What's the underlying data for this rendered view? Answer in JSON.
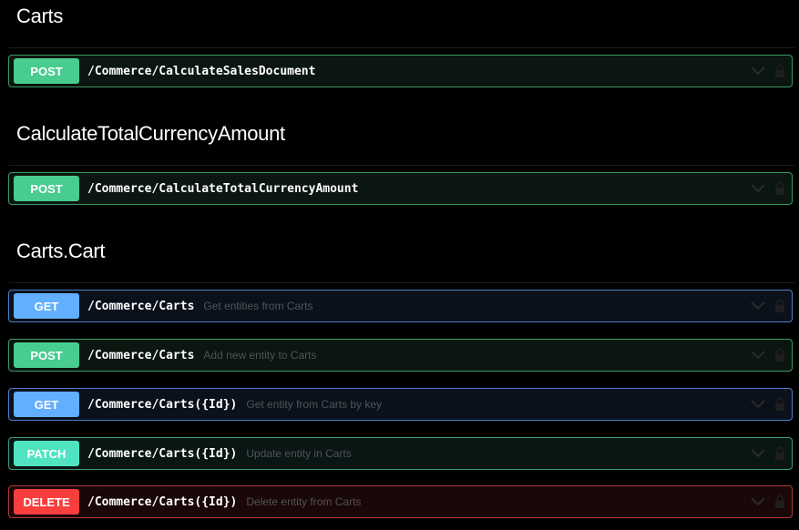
{
  "sections": [
    {
      "title": "Carts",
      "operations": [
        {
          "method": "POST",
          "path": "/Commerce/CalculateSalesDocument",
          "summary": ""
        }
      ]
    },
    {
      "title": "CalculateTotalCurrencyAmount",
      "operations": [
        {
          "method": "POST",
          "path": "/Commerce/CalculateTotalCurrencyAmount",
          "summary": ""
        }
      ]
    },
    {
      "title": "Carts.Cart",
      "operations": [
        {
          "method": "GET",
          "path": "/Commerce/Carts",
          "summary": "Get entities from Carts"
        },
        {
          "method": "POST",
          "path": "/Commerce/Carts",
          "summary": "Add new entity to Carts"
        },
        {
          "method": "GET",
          "path": "/Commerce/Carts({Id})",
          "summary": "Get entity from Carts by key"
        },
        {
          "method": "PATCH",
          "path": "/Commerce/Carts({Id})",
          "summary": "Update entity in Carts"
        },
        {
          "method": "DELETE",
          "path": "/Commerce/Carts({Id})",
          "summary": "Delete entity from Carts"
        }
      ]
    }
  ],
  "colors": {
    "post": "#49cc90",
    "get": "#61affe",
    "patch": "#50e3c2",
    "delete": "#f93e3e"
  },
  "icons": {
    "expand": "chevron-down-icon",
    "auth": "lock-icon"
  }
}
